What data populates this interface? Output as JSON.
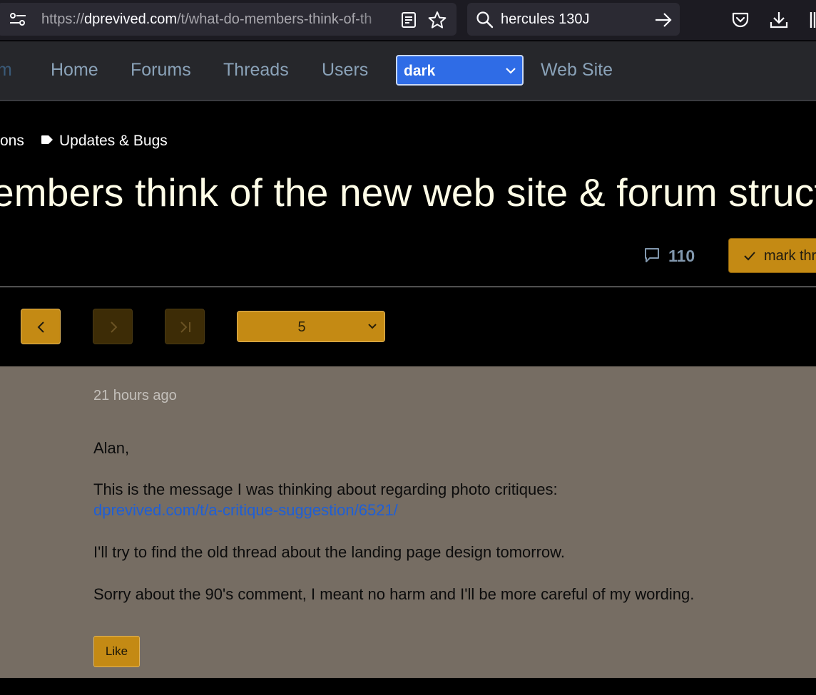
{
  "browser": {
    "url_prefix": "https://",
    "url_domain": "dprevived.com",
    "url_path": "/t/what-do-members-think-of-th",
    "search_value": "hercules 130J"
  },
  "nav": {
    "brand_partial": "m",
    "items": [
      "Home",
      "Forums",
      "Threads",
      "Users"
    ],
    "theme_value": "dark",
    "website_label": "Web Site"
  },
  "topic": {
    "category_partial": "ons",
    "tag": "Updates & Bugs",
    "title_partial": "embers think of the new web site & forum structu",
    "reply_count": "110",
    "mark_button_partial": "mark thr"
  },
  "pager": {
    "current_page": "5"
  },
  "post": {
    "timestamp": "21 hours ago",
    "greeting": "Alan,",
    "line1": "This is the message I was thinking about regarding photo critiques:",
    "link_text": "dprevived.com/t/a-critique-suggestion/6521/",
    "line2": "I'll try to find the old thread about the landing page design tomorrow.",
    "line3": "Sorry about the 90's comment, I meant no harm and I'll be more careful of my wording.",
    "like_label": "Like"
  },
  "colors": {
    "accent": "#c48a14",
    "theme_select": "#2f6ce6",
    "post_bg": "#766d63",
    "title": "#fffde7",
    "link": "#1f5fd6"
  }
}
